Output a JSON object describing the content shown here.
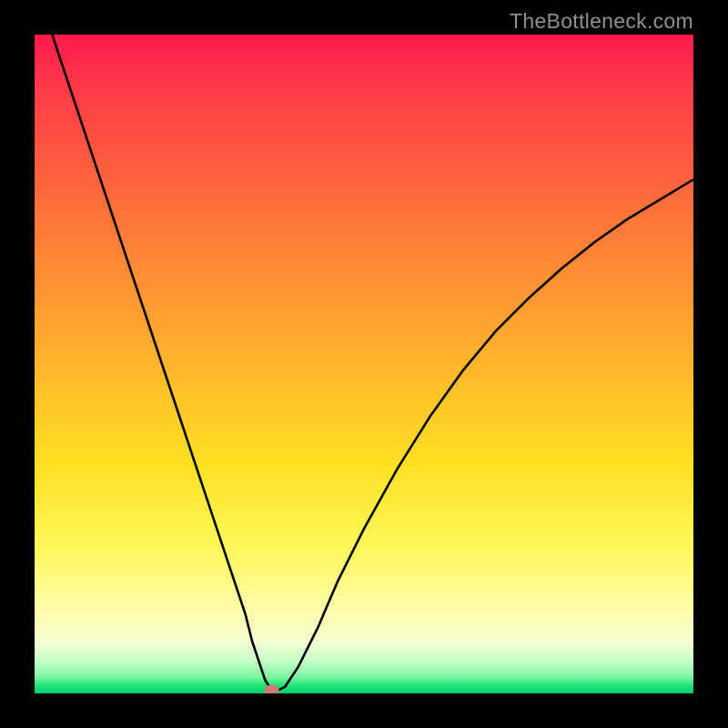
{
  "watermark": "TheBottleneck.com",
  "chart_data": {
    "type": "line",
    "title": "",
    "xlabel": "",
    "ylabel": "",
    "x_range": [
      0,
      100
    ],
    "y_range": [
      0,
      100
    ],
    "minimum_at_x_percent": 36,
    "series": [
      {
        "name": "bottleneck-curve",
        "x": [
          0,
          3,
          6,
          9,
          12,
          15,
          18,
          21,
          24,
          27,
          30,
          32,
          33,
          34,
          35,
          36,
          37,
          38,
          40,
          43,
          46,
          50,
          55,
          60,
          65,
          70,
          75,
          80,
          85,
          90,
          95,
          100
        ],
        "values": [
          110,
          99,
          90,
          81,
          72,
          63,
          54,
          45,
          36,
          27,
          18,
          12,
          8,
          5,
          2,
          0.5,
          0.5,
          1,
          4,
          10,
          17,
          25,
          34,
          42,
          49,
          55,
          60,
          64.5,
          68.5,
          72,
          75,
          78
        ]
      }
    ],
    "marker": {
      "x_percent": 36,
      "y_percent": 0.5,
      "color": "#cd7a76"
    },
    "gradient_stops": [
      {
        "p": 0,
        "c": "#ff1a4d"
      },
      {
        "p": 8,
        "c": "#ff3a48"
      },
      {
        "p": 20,
        "c": "#ff5d3f"
      },
      {
        "p": 35,
        "c": "#ff8a35"
      },
      {
        "p": 50,
        "c": "#ffb52c"
      },
      {
        "p": 65,
        "c": "#ffe022"
      },
      {
        "p": 78,
        "c": "#fff85a"
      },
      {
        "p": 87,
        "c": "#fffca8"
      },
      {
        "p": 92,
        "c": "#f5ffd0"
      },
      {
        "p": 95,
        "c": "#c8ffca"
      },
      {
        "p": 97.5,
        "c": "#7df5a1"
      },
      {
        "p": 98.7,
        "c": "#24e47a"
      },
      {
        "p": 100,
        "c": "#06cf6e"
      }
    ]
  }
}
